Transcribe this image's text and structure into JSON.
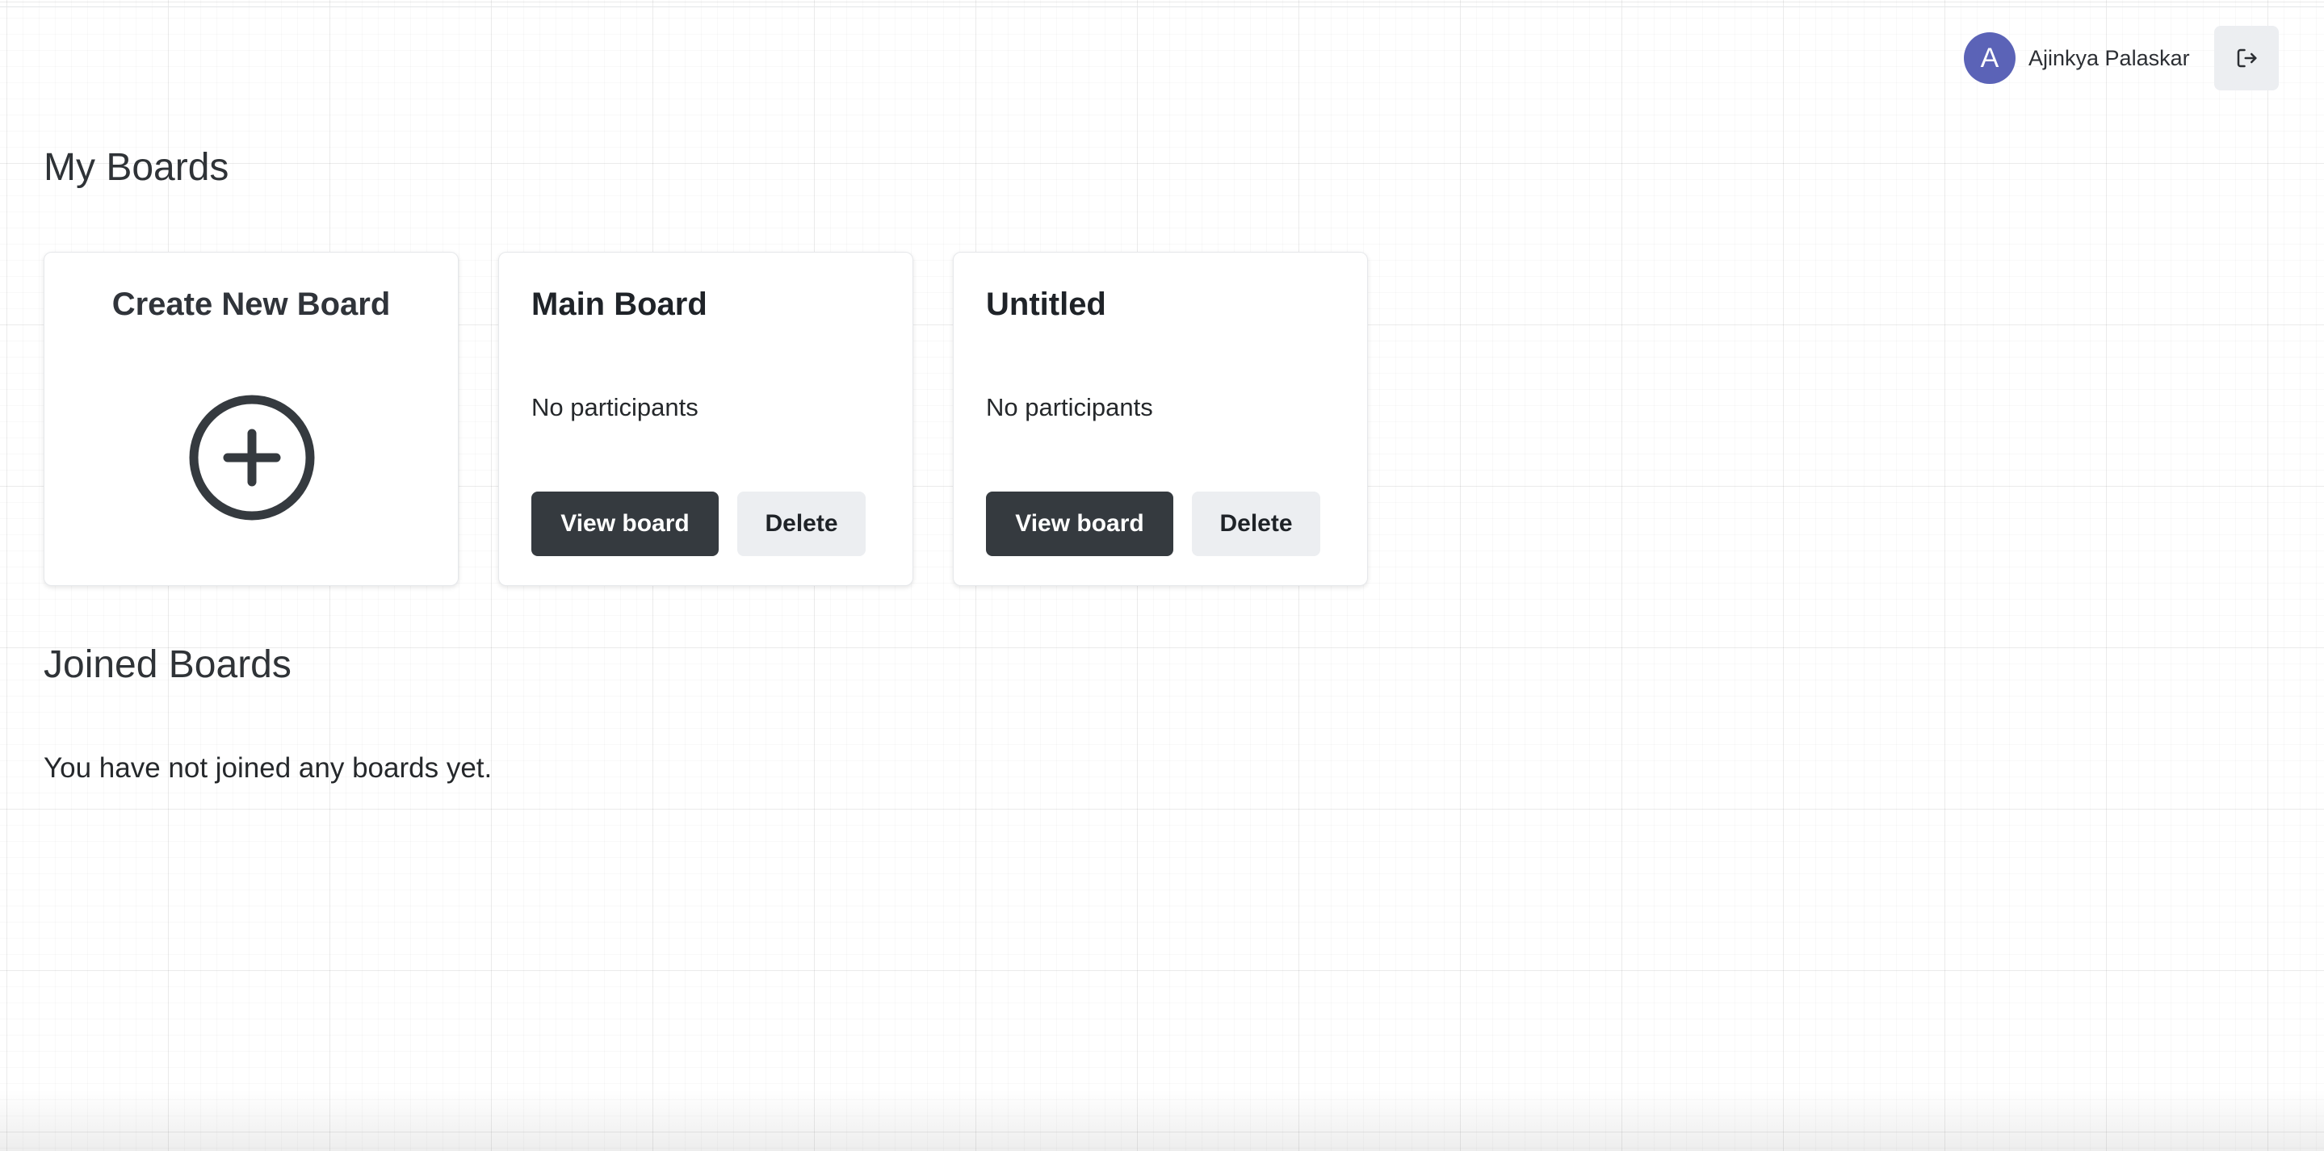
{
  "header": {
    "user": {
      "avatar_initial": "A",
      "name": "Ajinkya Palaskar"
    },
    "logout_icon": "logout-icon"
  },
  "my_boards": {
    "title": "My Boards",
    "create_card": {
      "label": "Create New Board",
      "icon": "plus-circle-icon"
    },
    "boards": [
      {
        "title": "Main Board",
        "participants": "No participants",
        "view_label": "View board",
        "delete_label": "Delete"
      },
      {
        "title": "Untitled",
        "participants": "No participants",
        "view_label": "View board",
        "delete_label": "Delete"
      }
    ]
  },
  "joined_boards": {
    "title": "Joined Boards",
    "empty_message": "You have not joined any boards yet."
  },
  "colors": {
    "avatar": "#5b63b7",
    "primary_button": "#353a3f",
    "secondary_button": "#eceef1"
  }
}
